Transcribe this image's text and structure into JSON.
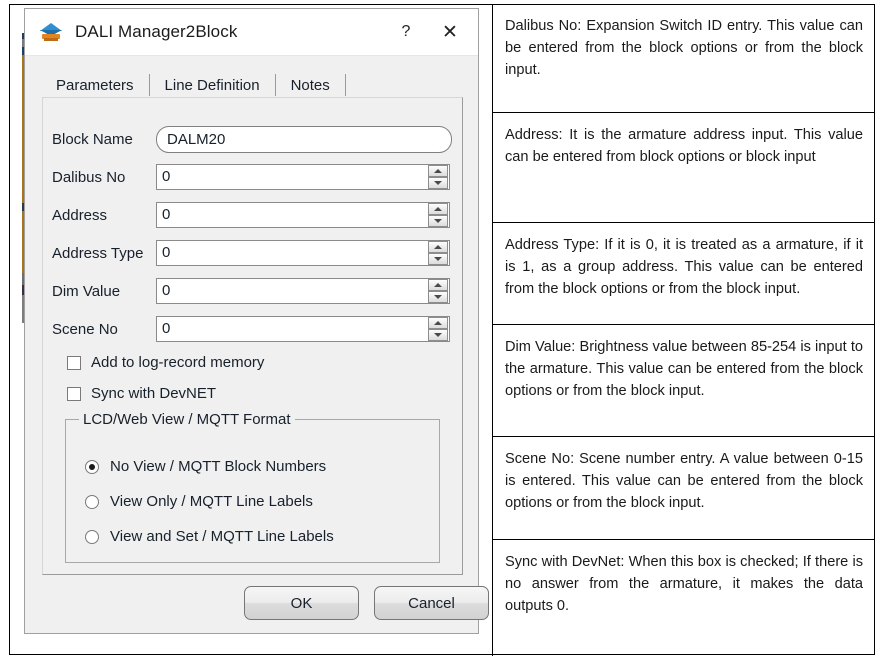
{
  "window": {
    "title": "DALI Manager2Block",
    "icon": "block-cube-icon",
    "help_label": "?",
    "close_label": "✕"
  },
  "tabs": [
    {
      "label": "Parameters",
      "active": true
    },
    {
      "label": "Line Definition",
      "active": false
    },
    {
      "label": "Notes",
      "active": false
    }
  ],
  "form": {
    "fields": [
      {
        "label": "Block Name",
        "value": "DALM20",
        "type": "text"
      },
      {
        "label": "Dalibus No",
        "value": "0",
        "type": "spinner"
      },
      {
        "label": "Address",
        "value": "0",
        "type": "spinner"
      },
      {
        "label": "Address Type",
        "value": "0",
        "type": "spinner"
      },
      {
        "label": "Dim Value",
        "value": "0",
        "type": "spinner"
      },
      {
        "label": "Scene No",
        "value": "0",
        "type": "spinner"
      }
    ]
  },
  "checkboxes": [
    {
      "label": "Add to log-record memory",
      "checked": false
    },
    {
      "label": "Sync with DevNET",
      "checked": false
    }
  ],
  "groupbox": {
    "legend": "LCD/Web View / MQTT Format",
    "options": [
      {
        "label": "No View / MQTT Block Numbers",
        "selected": true
      },
      {
        "label": "View Only / MQTT Line Labels",
        "selected": false
      },
      {
        "label": "View and Set / MQTT Line Labels",
        "selected": false
      }
    ]
  },
  "buttons": {
    "ok": "OK",
    "cancel": "Cancel"
  },
  "docs": {
    "entries": [
      "Dalibus No:  Expansion Switch ID entry. This value can be entered from the block options or from the block input.",
      "Address:  It is the armature address input. This value can be entered from block options or block input",
      "Address Type:  If it is 0, it is treated as a armature, if it is 1, as a group address. This value can be entered from the block options or from the block input.",
      "Dim Value:  Brightness value between 85-254 is input to the armature. This value can be entered from the block options or from the block input.",
      "Scene No:  Scene number entry. A value between 0-15 is entered. This value can be entered from the block options or from the block input.",
      "Sync with DevNet: When this box is checked; If there is no answer from the armature, it makes the data outputs 0."
    ],
    "heights": [
      109,
      110,
      102,
      112,
      103,
      115
    ]
  },
  "colors": {
    "dialog_background": "#f0f0f0",
    "titlebar_background": "#ffffff",
    "text": "#17202b",
    "border": "#a0a0a0",
    "field_background": "#ffffff"
  }
}
